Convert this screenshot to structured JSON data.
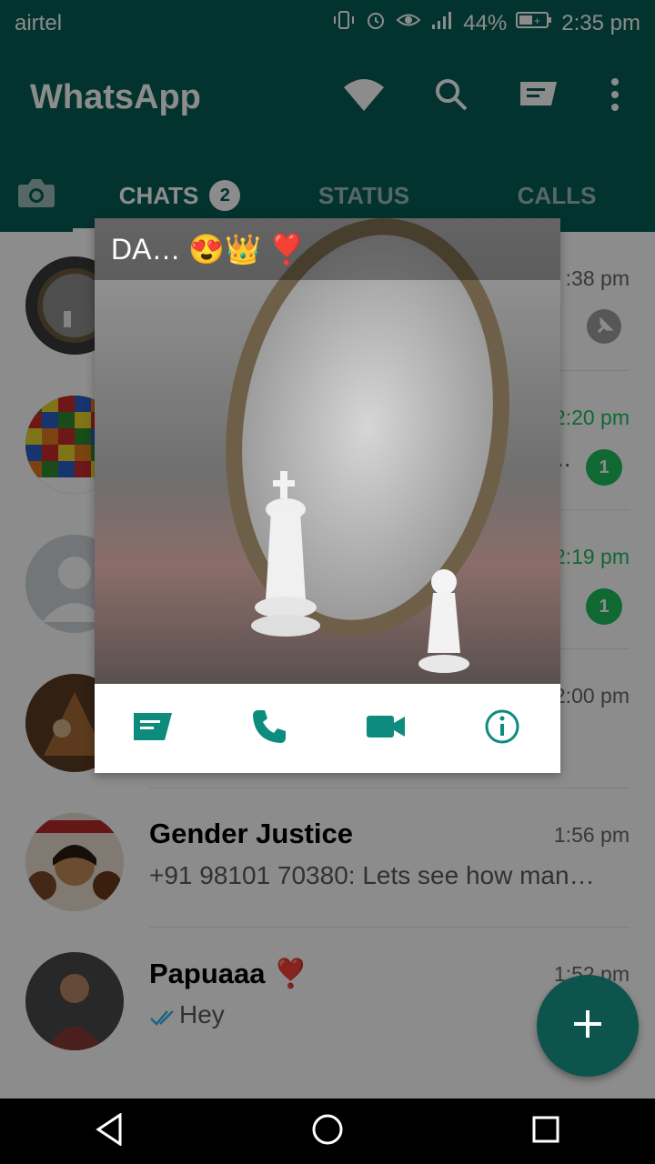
{
  "status_bar": {
    "carrier": "airtel",
    "battery": "44%",
    "time": "2:35 pm"
  },
  "app_bar": {
    "title": "WhatsApp",
    "icons": [
      "wifi-icon",
      "search-icon",
      "new-chat-icon",
      "more-vert-icon"
    ]
  },
  "tabs": [
    {
      "label": "",
      "icon": "camera-icon"
    },
    {
      "label": "CHATS",
      "badge": "2"
    },
    {
      "label": "STATUS"
    },
    {
      "label": "CALLS"
    }
  ],
  "chats": [
    {
      "name": "",
      "message": "",
      "time": ":38 pm",
      "pinned": true
    },
    {
      "name": "",
      "message": "..",
      "time": "2:20 pm",
      "unread": "1"
    },
    {
      "name": "",
      "message": "",
      "time": "2:19 pm",
      "unread": "1"
    },
    {
      "name": "",
      "message": "",
      "time": "2:00 pm"
    },
    {
      "name": "Gender Justice",
      "message": "+91 98101 70380: Lets see how man…",
      "time": "1:56 pm"
    },
    {
      "name": "Papuaaa ❣️",
      "message": "Hey",
      "time": "1:52 pm",
      "double_tick": true
    }
  ],
  "popup": {
    "title": "DA… 😍👑 ❣️",
    "actions": [
      "message-icon",
      "call-icon",
      "video-call-icon",
      "info-icon"
    ]
  },
  "colors": {
    "primary": "#075e54",
    "accent_green": "#1ebe5d",
    "icon_teal": "#0d8c7e",
    "fab": "#0d544c"
  }
}
